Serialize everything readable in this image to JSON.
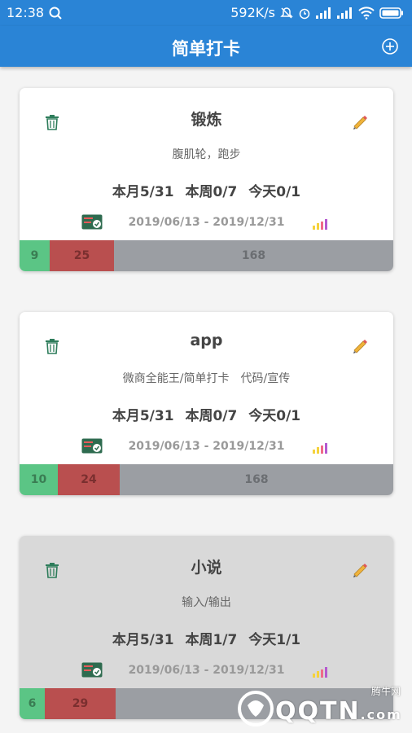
{
  "status_bar": {
    "time": "12:38",
    "speed": "592K/s"
  },
  "app_bar": {
    "title": "简单打卡"
  },
  "cards": [
    {
      "title": "锻炼",
      "description": "腹肌轮，跑步",
      "stats": {
        "month": "本月5/31",
        "week": "本周0/7",
        "today": "今天0/1"
      },
      "date_range": "2019/06/13 - 2019/12/31",
      "progress": {
        "done": "9",
        "missed": "25",
        "remaining": "168"
      }
    },
    {
      "title": "app",
      "description": "微商全能王/简单打卡　代码/宣传",
      "stats": {
        "month": "本月5/31",
        "week": "本周0/7",
        "today": "今天0/1"
      },
      "date_range": "2019/06/13 - 2019/12/31",
      "progress": {
        "done": "10",
        "missed": "24",
        "remaining": "168"
      }
    },
    {
      "title": "小说",
      "description": "输入/输出",
      "stats": {
        "month": "本月5/31",
        "week": "本周1/7",
        "today": "今天1/1"
      },
      "date_range": "2019/06/13 - 2019/12/31",
      "progress": {
        "done": "6",
        "missed": "29",
        "remaining": ""
      }
    }
  ],
  "watermark": {
    "brand": "QQTN",
    "suffix": ".com",
    "small": "腾牛网"
  }
}
